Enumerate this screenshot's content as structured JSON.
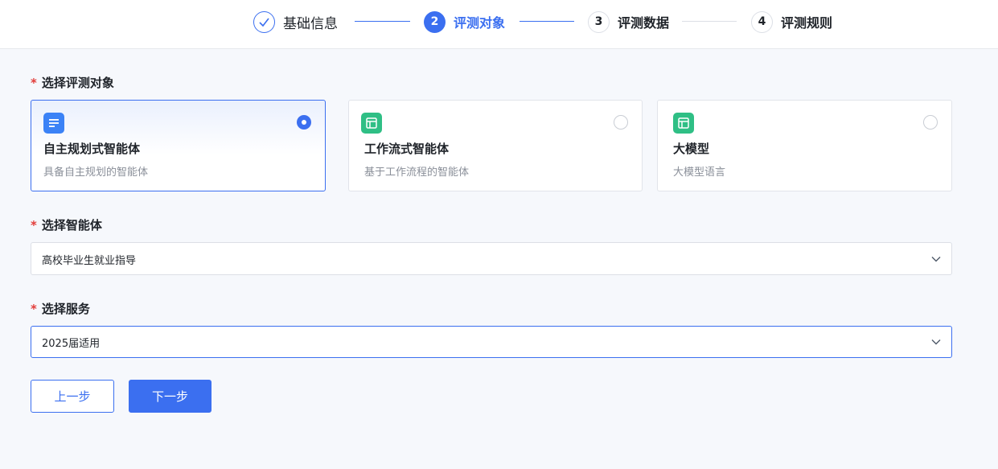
{
  "stepper": {
    "steps": [
      {
        "number": "",
        "label": "基础信息",
        "state": "done",
        "icon": "check-icon"
      },
      {
        "number": "2",
        "label": "评测对象",
        "state": "active"
      },
      {
        "number": "3",
        "label": "评测数据",
        "state": "todo"
      },
      {
        "number": "4",
        "label": "评测规则",
        "state": "todo"
      }
    ]
  },
  "target_section": {
    "required_mark": "*",
    "label": "选择评测对象",
    "options": [
      {
        "title": "自主规划式智能体",
        "desc": "具备自主规划的智能体",
        "icon": "document-list-icon",
        "selected": true
      },
      {
        "title": "工作流式智能体",
        "desc": "基于工作流程的智能体",
        "icon": "layout-table-icon",
        "selected": false
      },
      {
        "title": "大模型",
        "desc": "大模型语言",
        "icon": "layout-table-icon",
        "selected": false
      }
    ]
  },
  "agent_section": {
    "required_mark": "*",
    "label": "选择智能体",
    "value": "高校毕业生就业指导",
    "icon": "chevron-down-icon"
  },
  "service_section": {
    "required_mark": "*",
    "label": "选择服务",
    "value": "2025届适用",
    "icon": "chevron-down-icon"
  },
  "actions": {
    "prev_label": "上一步",
    "next_label": "下一步"
  },
  "colors": {
    "primary": "#3b6ff0",
    "required": "#e23c39",
    "icon_blue": "#3b82f6",
    "icon_green": "#2fbf85"
  }
}
